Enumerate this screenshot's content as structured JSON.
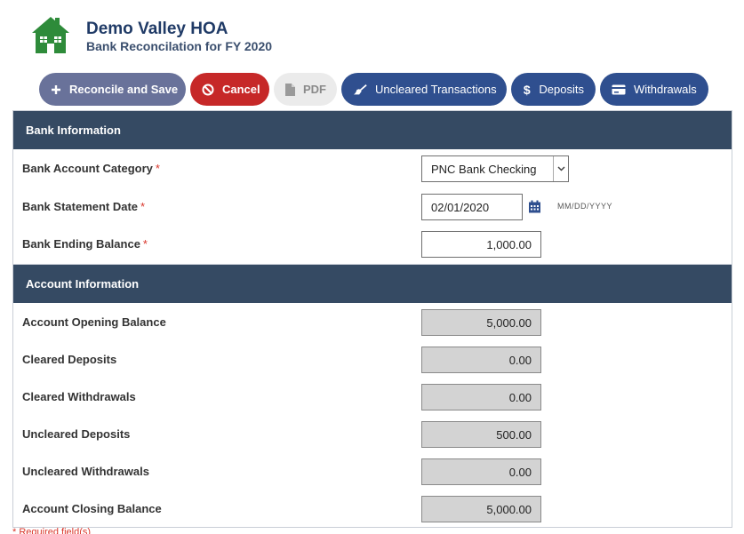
{
  "header": {
    "org_name": "Demo Valley HOA",
    "subtitle": "Bank Reconcilation for FY 2020",
    "logo_icon": "house-icon",
    "logo_color": "#2e8b3a"
  },
  "toolbar": {
    "reconcile_label": "Reconcile and Save",
    "cancel_label": "Cancel",
    "pdf_label": "PDF",
    "uncleared_label": "Uncleared Transactions",
    "deposits_label": "Deposits",
    "withdrawals_label": "Withdrawals"
  },
  "bank_info": {
    "title": "Bank Information",
    "category_label": "Bank Account Category",
    "category_value": "PNC Bank Checking",
    "statement_date_label": "Bank Statement Date",
    "statement_date_value": "02/01/2020",
    "date_format_hint": "MM/DD/YYYY",
    "ending_balance_label": "Bank Ending Balance",
    "ending_balance_value": "1,000.00",
    "required_mark": "*"
  },
  "account_info": {
    "title": "Account Information",
    "rows": [
      {
        "label": "Account Opening Balance",
        "value": "5,000.00"
      },
      {
        "label": "Cleared Deposits",
        "value": "0.00"
      },
      {
        "label": "Cleared Withdrawals",
        "value": "0.00"
      },
      {
        "label": "Uncleared Deposits",
        "value": "500.00"
      },
      {
        "label": "Uncleared Withdrawals",
        "value": "0.00"
      },
      {
        "label": "Account Closing Balance",
        "value": "5,000.00"
      }
    ]
  },
  "footer": {
    "required_note": "* Required field(s)"
  },
  "colors": {
    "panel_header": "#354a63",
    "primary_button": "#2f4f8f",
    "cancel_button": "#c62828",
    "reconcile_button": "#69729a",
    "required": "#d9362b"
  }
}
